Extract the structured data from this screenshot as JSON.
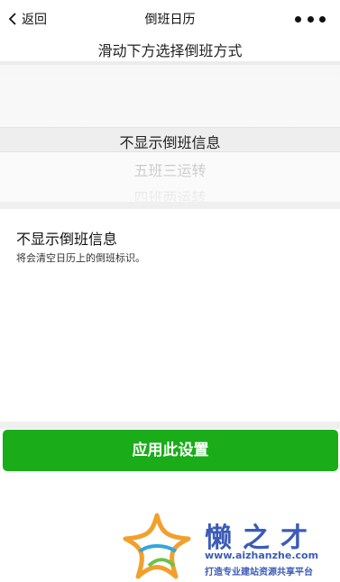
{
  "nav": {
    "back_label": "返回",
    "title": "倒班日历",
    "back_icon": "chevron-left-icon",
    "more_icon": "more-dots-icon"
  },
  "subtitle": "滑动下方选择倒班方式",
  "picker": {
    "options": [
      "不显示倒班信息",
      "五班三运转",
      "四班两运转"
    ],
    "selected": "不显示倒班信息"
  },
  "info": {
    "heading": "不显示倒班信息",
    "description": "将会清空日历上的倒班标识。"
  },
  "apply_button": "应用此设置",
  "colors": {
    "accent": "#1aad19",
    "watermark": "#3b5bb8"
  },
  "watermark": {
    "brand": "懒之才",
    "url": "www.aizhanzhe.com",
    "slogan": "打造专业建站资源共享平台"
  }
}
